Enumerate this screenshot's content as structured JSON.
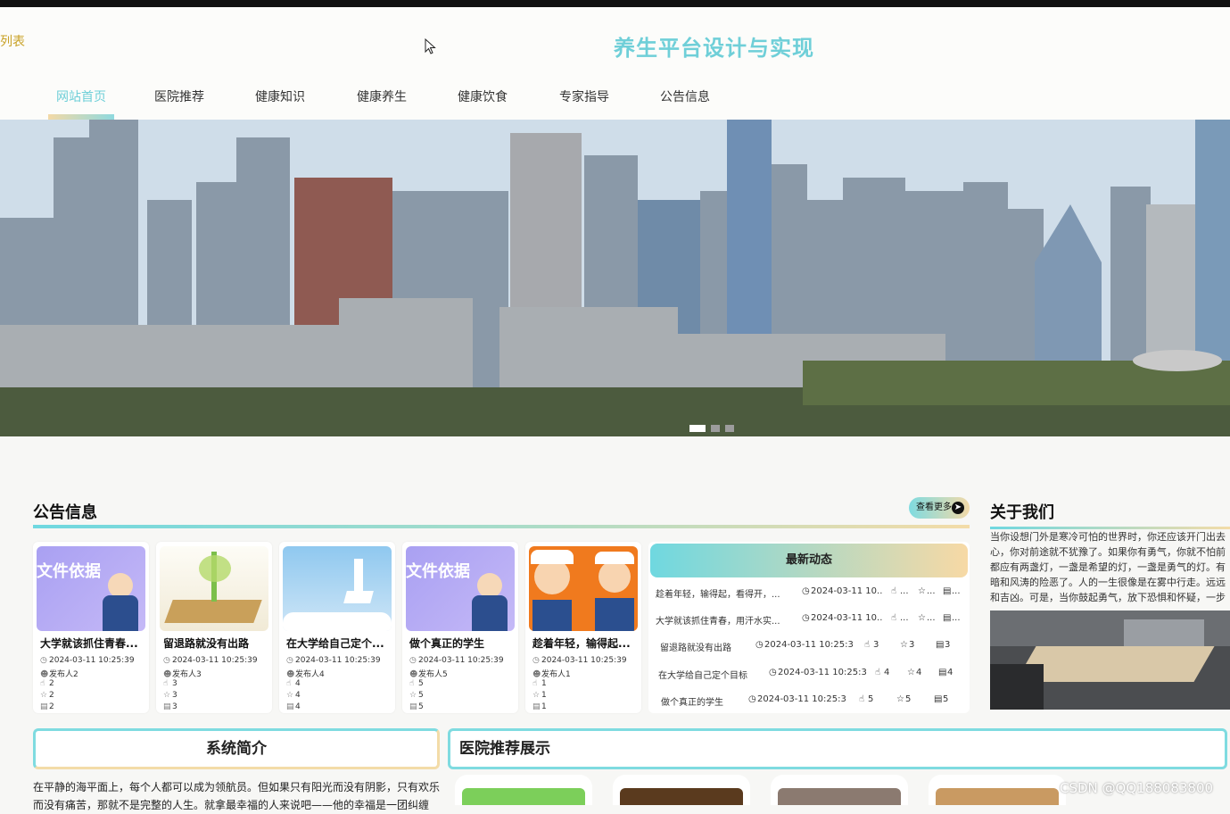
{
  "header": {
    "list_link": "列表",
    "site_title": "养生平台设计与实现"
  },
  "nav": {
    "items": [
      {
        "label": "网站首页",
        "active": true
      },
      {
        "label": "医院推荐"
      },
      {
        "label": "健康知识"
      },
      {
        "label": "健康养生"
      },
      {
        "label": "健康饮食"
      },
      {
        "label": "专家指导"
      },
      {
        "label": "公告信息"
      }
    ]
  },
  "banner": {
    "image": "city-skyline-photo",
    "slides": 3,
    "active_slide": 1
  },
  "notice": {
    "title": "公告信息",
    "more_label": "查看更多",
    "cards": [
      {
        "title": "大学就该抓住青春...",
        "thumb_text": "文件依据",
        "date": "2024-03-11 10:25:39",
        "author": "发布人2",
        "likes": "2",
        "favs": "2",
        "comments": "2"
      },
      {
        "title": "留退路就没有出路",
        "thumb_text": "",
        "date": "2024-03-11 10:25:39",
        "author": "发布人3",
        "likes": "3",
        "favs": "3",
        "comments": "3"
      },
      {
        "title": "在大学给自己定个...",
        "thumb_text": "",
        "date": "2024-03-11 10:25:39",
        "author": "发布人4",
        "likes": "4",
        "favs": "4",
        "comments": "4"
      },
      {
        "title": "做个真正的学生",
        "thumb_text": "文件依据",
        "date": "2024-03-11 10:25:39",
        "author": "发布人5",
        "likes": "5",
        "favs": "5",
        "comments": "5"
      },
      {
        "title": "趁着年轻，输得起...",
        "thumb_text": "",
        "date": "2024-03-11 10:25:39",
        "author": "发布人1",
        "likes": "1",
        "favs": "1",
        "comments": "1"
      }
    ]
  },
  "news": {
    "title": "最新动态",
    "rows": [
      {
        "title": "趁着年轻，输得起，看得开，...",
        "date": "2024-03-11 10...",
        "likes": "...",
        "favs": "...",
        "comments": "..."
      },
      {
        "title": "大学就该抓住青春，用汗水实...",
        "date": "2024-03-11 10...",
        "likes": "...",
        "favs": "...",
        "comments": "..."
      },
      {
        "title": "留退路就没有出路",
        "date": "2024-03-11 10:25:39",
        "likes": "3",
        "favs": "3",
        "comments": "3"
      },
      {
        "title": "在大学给自己定个目标",
        "date": "2024-03-11 10:25:39",
        "likes": "4",
        "favs": "4",
        "comments": "4"
      },
      {
        "title": "做个真正的学生",
        "date": "2024-03-11 10:25:39",
        "likes": "5",
        "favs": "5",
        "comments": "5"
      }
    ]
  },
  "about": {
    "title": "关于我们",
    "text": "当你设想门外是寒冷可怕的世界时，你还应该开门出去\n心，你对前途就不犹豫了。如果你有勇气，你就不怕前\n都应有两盏灯，一盏是希望的灯，一盏是勇气的灯。有\n暗和风涛的险恶了。人的一生很像是在雾中行走。远远\n和吉凶。可是，当你鼓起勇气，放下恐惧和怀疑，一步"
  },
  "intro": {
    "title": "系统简介",
    "text": "在平静的海平面上，每个人都可以成为领航员。但如果只有阳光而没有阴影，只有欢乐\n而没有痛苦，那就不是完整的人生。就拿最幸福的人来说吧——他的幸福是一团纠缠"
  },
  "hospital": {
    "title": "医院推荐展示"
  },
  "watermark": "CSDN @QQ188083800"
}
